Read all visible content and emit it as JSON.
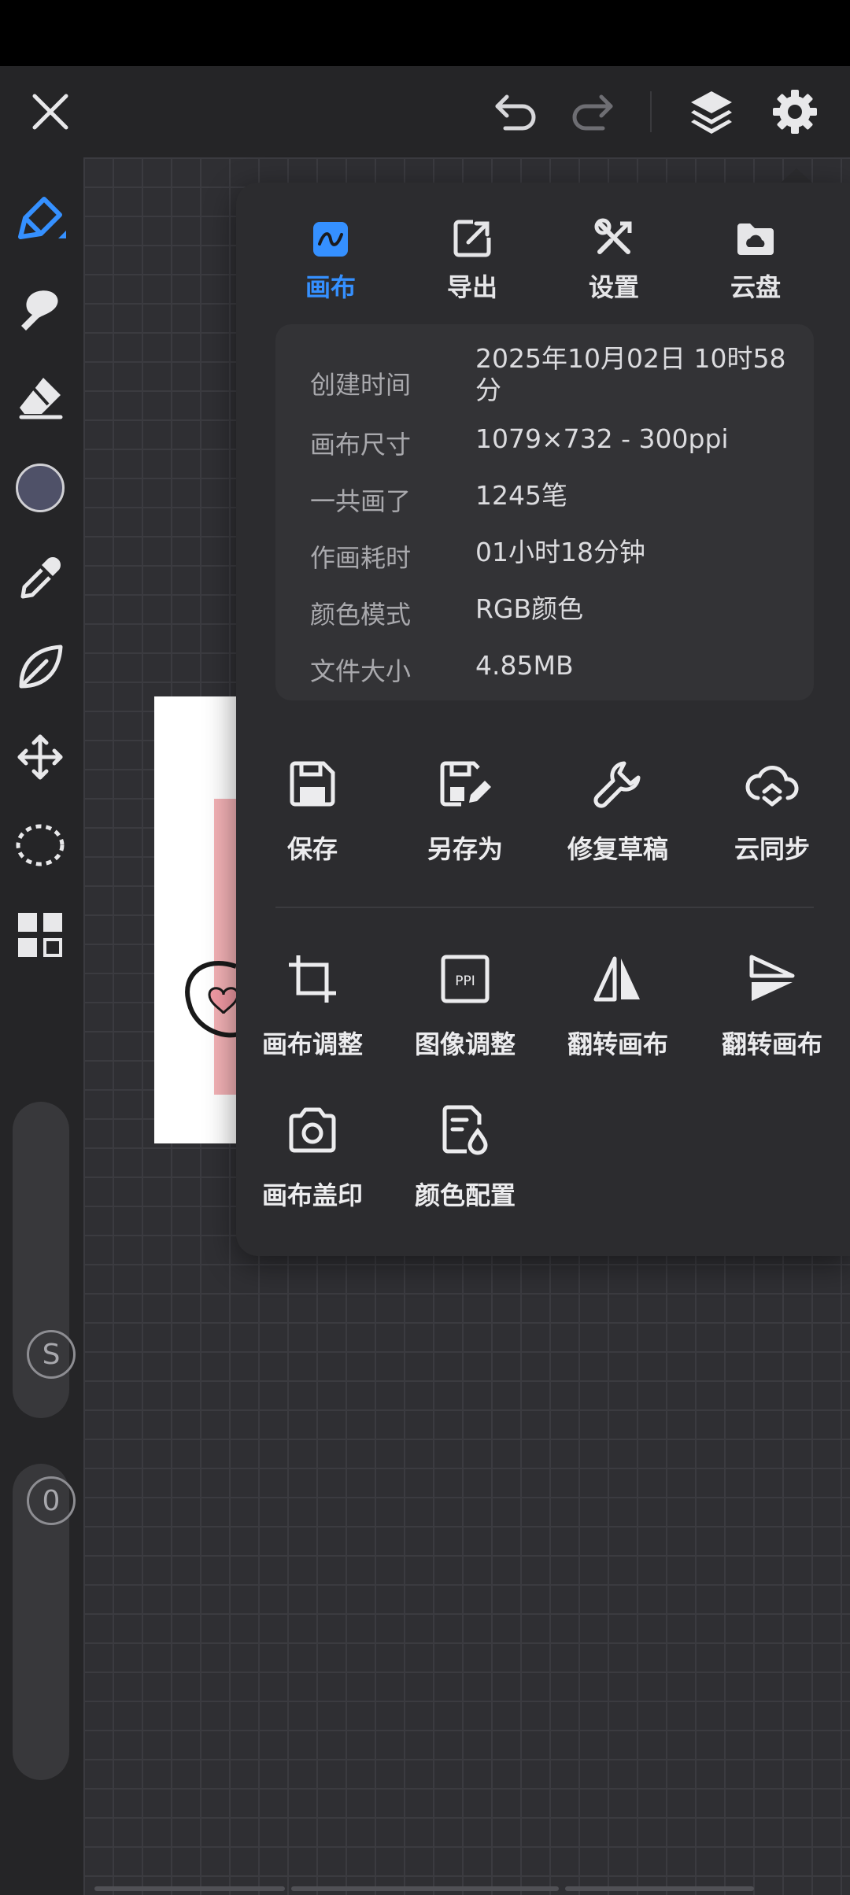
{
  "panel": {
    "tabs": [
      {
        "label": "画布",
        "icon": "canvas-tab-icon",
        "active": true
      },
      {
        "label": "导出",
        "icon": "export-icon",
        "active": false
      },
      {
        "label": "设置",
        "icon": "tools-settings-icon",
        "active": false
      },
      {
        "label": "云盘",
        "icon": "cloud-drive-icon",
        "active": false
      }
    ],
    "info": [
      {
        "label": "创建时间",
        "value": "2025年10月02日 10时58分"
      },
      {
        "label": "画布尺寸",
        "value": "1079×732 - 300ppi"
      },
      {
        "label": "一共画了",
        "value": "1245笔"
      },
      {
        "label": "作画耗时",
        "value": "01小时18分钟"
      },
      {
        "label": "颜色模式",
        "value": "RGB颜色"
      },
      {
        "label": "文件大小",
        "value": "4.85MB"
      }
    ],
    "actions_row1": [
      {
        "label": "保存",
        "icon": "save-icon"
      },
      {
        "label": "另存为",
        "icon": "save-as-icon"
      },
      {
        "label": "修复草稿",
        "icon": "wrench-icon"
      },
      {
        "label": "云同步",
        "icon": "cloud-sync-icon"
      }
    ],
    "actions_row2": [
      {
        "label": "画布调整",
        "icon": "crop-icon"
      },
      {
        "label": "图像调整",
        "icon": "ppi-icon"
      },
      {
        "label": "翻转画布",
        "icon": "flip-horizontal-icon"
      },
      {
        "label": "翻转画布",
        "icon": "flip-vertical-icon"
      }
    ],
    "actions_row3": [
      {
        "label": "画布盖印",
        "icon": "camera-icon"
      },
      {
        "label": "颜色配置",
        "icon": "color-profile-icon"
      }
    ]
  },
  "left_toolbar": {
    "current_color": "#4f5168",
    "slider_size_badge": "S",
    "slider_opacity_badge": "0"
  },
  "colors": {
    "accent": "#3590ff",
    "panel_bg": "#2c2c2f",
    "toolbar_bg": "#252527"
  }
}
